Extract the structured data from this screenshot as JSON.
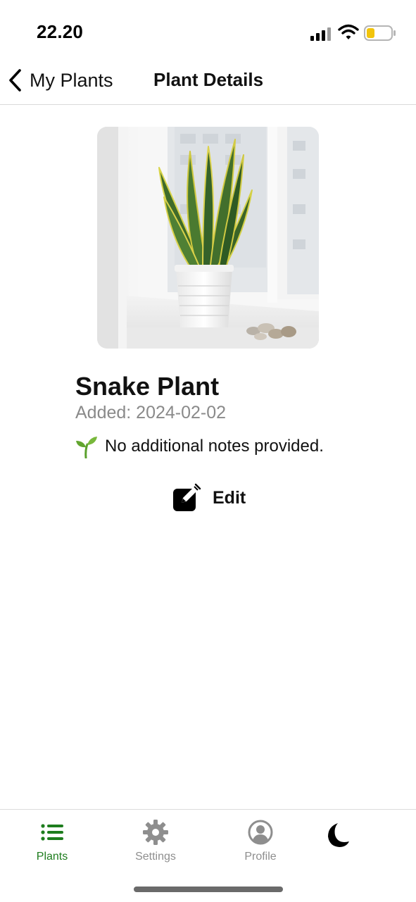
{
  "status_bar": {
    "time": "22.20",
    "battery_color": "#f2c40c"
  },
  "nav": {
    "back_label": "My Plants",
    "title": "Plant Details"
  },
  "plant": {
    "name": "Snake Plant",
    "added": "Added: 2024-02-02",
    "notes": "No additional notes provided.",
    "photo_alt": "snake plant in white pot on window sill"
  },
  "actions": {
    "edit_label": "Edit"
  },
  "tabs": [
    {
      "label": "Plants",
      "icon": "list-icon",
      "active": true
    },
    {
      "label": "Settings",
      "icon": "gear-icon",
      "active": false
    },
    {
      "label": "Profile",
      "icon": "profile-icon",
      "active": false
    }
  ],
  "colors": {
    "accent": "#1e7d1e",
    "inactive": "#8e8e8e"
  }
}
